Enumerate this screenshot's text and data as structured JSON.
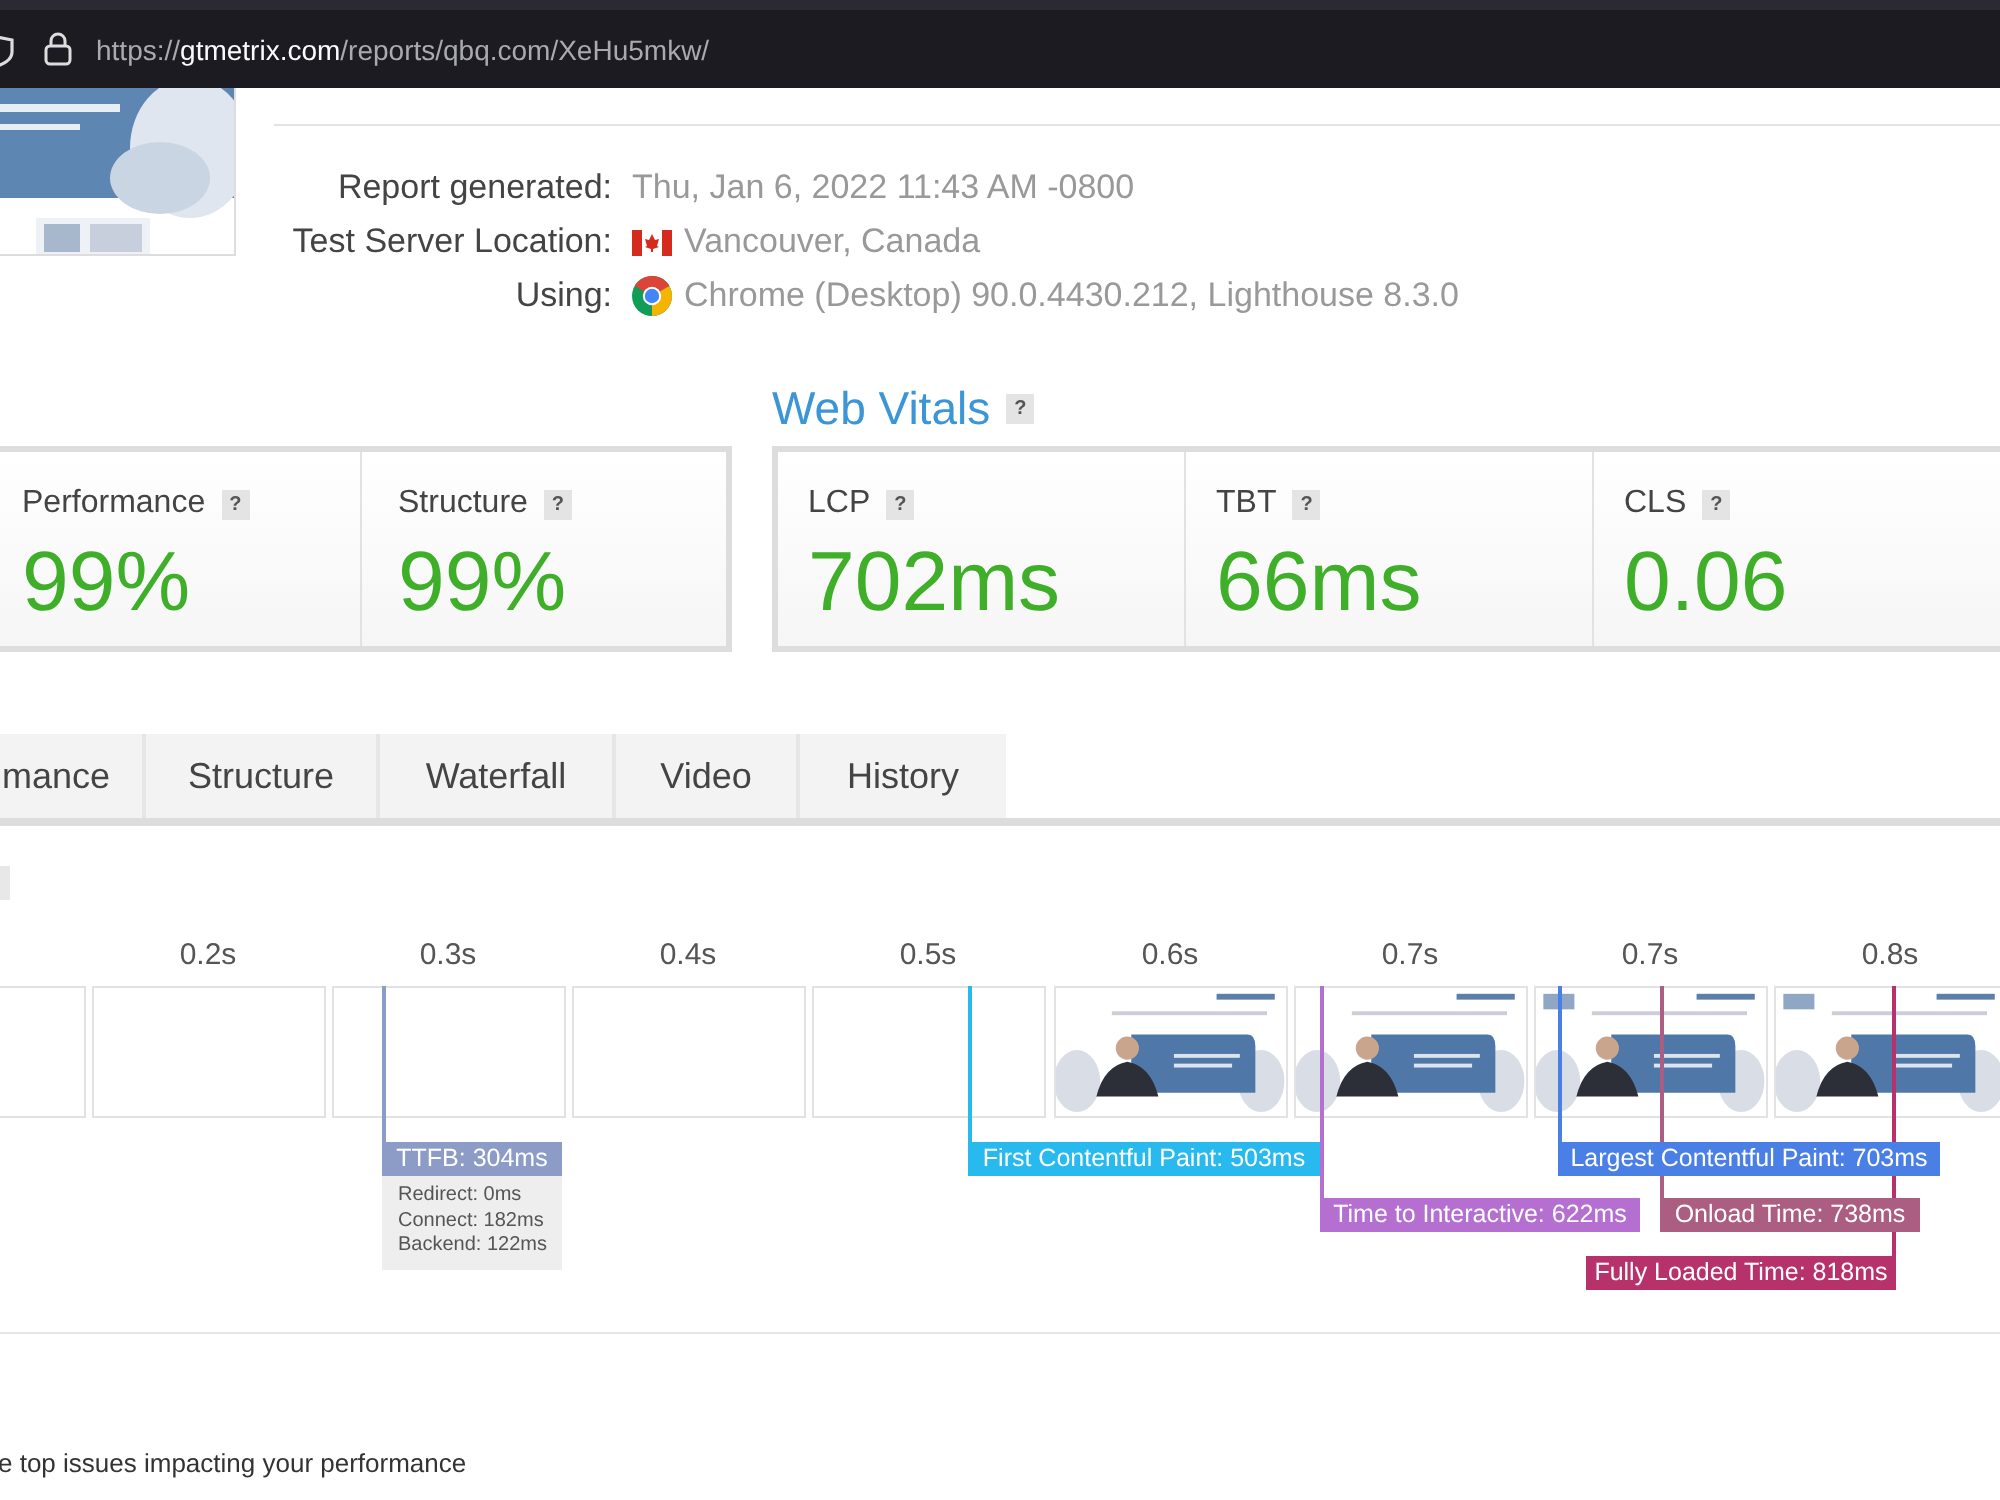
{
  "browser": {
    "url": {
      "scheme": "https://",
      "host": "gtmetrix.com",
      "path": "/reports/qbq.com/XeHu5mkw/"
    }
  },
  "report_info": [
    {
      "kind": "plain",
      "label": "Report generated:",
      "value": "Thu, Jan 6, 2022 11:43 AM -0800"
    },
    {
      "kind": "location",
      "label": "Test Server Location:",
      "value": "Vancouver, Canada"
    },
    {
      "kind": "browser",
      "label": "Using:",
      "value": "Chrome (Desktop) 90.0.4430.212, Lighthouse 8.3.0"
    }
  ],
  "grades": [
    {
      "label": "Performance",
      "help": "?",
      "value": "99%"
    },
    {
      "label": "Structure",
      "help": "?",
      "value": "99%"
    }
  ],
  "web_vitals": {
    "title": "Web Vitals",
    "help": "?",
    "metrics": [
      {
        "label": "LCP",
        "help": "?",
        "value": "702ms"
      },
      {
        "label": "TBT",
        "help": "?",
        "value": "66ms"
      },
      {
        "label": "CLS",
        "help": "?",
        "value": "0.06"
      }
    ]
  },
  "tabs": [
    {
      "label": "mance",
      "selected": false
    },
    {
      "label": "Structure",
      "selected": false
    },
    {
      "label": "Waterfall",
      "selected": false
    },
    {
      "label": "Video",
      "selected": false
    },
    {
      "label": "History",
      "selected": false
    }
  ],
  "filmstrip": {
    "frames": [
      {
        "kind": "blank"
      },
      {
        "kind": "blank",
        "time": "0.2s"
      },
      {
        "kind": "blank",
        "time": "0.3s"
      },
      {
        "kind": "blank",
        "time": "0.4s"
      },
      {
        "kind": "blank",
        "time": "0.5s"
      },
      {
        "kind": "picture",
        "time": "0.6s"
      },
      {
        "kind": "picture",
        "time": "0.7s"
      },
      {
        "kind": "picture",
        "time": "0.7s"
      },
      {
        "kind": "picture",
        "time": "0.8s"
      }
    ],
    "markers": [
      {
        "label": "TTFB: 304ms",
        "color": "#8c9cc6",
        "details": [
          "Redirect: 0ms",
          "Connect: 182ms",
          "Backend: 122ms"
        ]
      },
      {
        "label": "First Contentful Paint: 503ms",
        "color": "#28b9ef"
      },
      {
        "label": "Time to Interactive: 622ms",
        "color": "#b56fd0"
      },
      {
        "label": "Largest Contentful Paint: 703ms",
        "color": "#4a7fe6"
      },
      {
        "label": "Onload Time: 738ms",
        "color": "#ac5d82"
      },
      {
        "label": "Fully Loaded Time: 818ms",
        "color": "#b7326b"
      }
    ]
  },
  "footer_text": "e top issues impacting your performance"
}
